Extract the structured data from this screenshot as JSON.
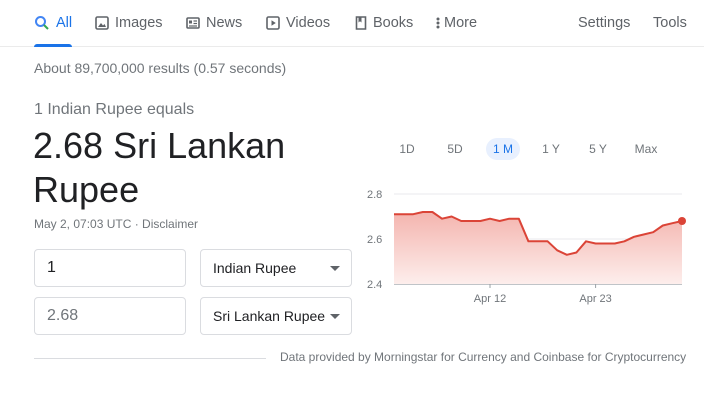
{
  "tabs": [
    {
      "label": "All",
      "icon": "search-icon",
      "active": true
    },
    {
      "label": "Images",
      "icon": "image-icon",
      "active": false
    },
    {
      "label": "News",
      "icon": "news-icon",
      "active": false
    },
    {
      "label": "Videos",
      "icon": "video-icon",
      "active": false
    },
    {
      "label": "Books",
      "icon": "book-icon",
      "active": false
    },
    {
      "label": "More",
      "icon": "more-vert-icon",
      "active": false
    }
  ],
  "tools": {
    "settings_label": "Settings",
    "tools_label": "Tools"
  },
  "result_stats": "About 89,700,000 results (0.57 seconds)",
  "converter": {
    "equals_text": "1 Indian Rupee equals",
    "value_line1": "2.68 Sri Lankan",
    "value_line2": "Rupee",
    "timestamp": "May 2, 07:03 UTC",
    "separator": " · ",
    "disclaimer": "Disclaimer",
    "from_amount": "1",
    "from_currency": "Indian Rupee",
    "to_amount": "2.68",
    "to_currency": "Sri Lankan Rupee"
  },
  "range_buttons": [
    {
      "label": "1D",
      "active": false
    },
    {
      "label": "5D",
      "active": false
    },
    {
      "label": "1 M",
      "active": true
    },
    {
      "label": "1 Y",
      "active": false
    },
    {
      "label": "5 Y",
      "active": false
    },
    {
      "label": "Max",
      "active": false
    }
  ],
  "source_text": "Data provided by Morningstar for Currency and Coinbase for Cryptocurrency",
  "colors": {
    "accent": "#1a73e8",
    "line": "#db4437",
    "fill_top": "#f4b4ae",
    "fill_bottom": "#fdeeec"
  },
  "chart_data": {
    "type": "area",
    "x_ticks": [
      "Apr 12",
      "Apr 23"
    ],
    "y_ticks": [
      2.8,
      2.6,
      2.4
    ],
    "ylim": [
      2.4,
      2.8
    ],
    "x": [
      "Apr 2",
      "Apr 3",
      "Apr 4",
      "Apr 5",
      "Apr 6",
      "Apr 7",
      "Apr 8",
      "Apr 9",
      "Apr 10",
      "Apr 11",
      "Apr 12",
      "Apr 13",
      "Apr 14",
      "Apr 15",
      "Apr 16",
      "Apr 17",
      "Apr 18",
      "Apr 19",
      "Apr 20",
      "Apr 21",
      "Apr 22",
      "Apr 23",
      "Apr 24",
      "Apr 25",
      "Apr 26",
      "Apr 27",
      "Apr 28",
      "Apr 29",
      "Apr 30",
      "May 1",
      "May 2"
    ],
    "series": [
      {
        "values": [
          2.71,
          2.71,
          2.71,
          2.72,
          2.72,
          2.69,
          2.7,
          2.68,
          2.68,
          2.68,
          2.69,
          2.68,
          2.69,
          2.69,
          2.59,
          2.59,
          2.59,
          2.55,
          2.53,
          2.54,
          2.59,
          2.58,
          2.58,
          2.58,
          2.59,
          2.61,
          2.62,
          2.63,
          2.66,
          2.67,
          2.68
        ]
      }
    ],
    "grid": true
  }
}
